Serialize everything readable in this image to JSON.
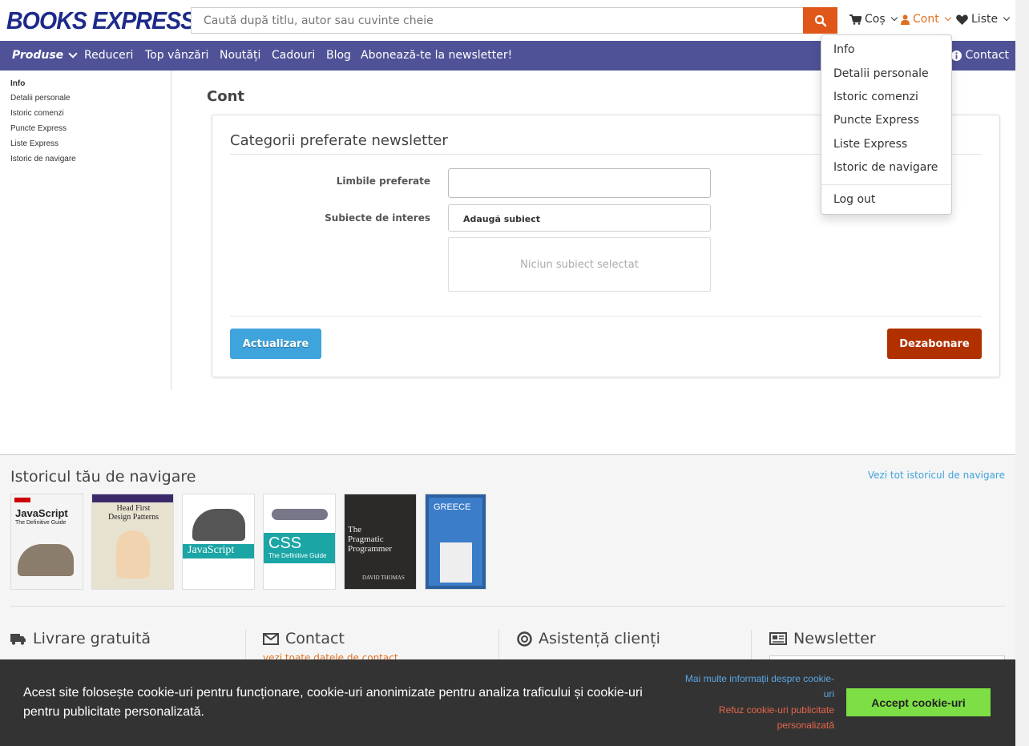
{
  "header": {
    "logo": "BOOKS EXPRESS",
    "search_placeholder": "Caută după titlu, autor sau cuvinte cheie",
    "cart_label": "Coș",
    "account_label": "Cont",
    "lists_label": "Liste"
  },
  "nav": {
    "products": "Produse",
    "items": [
      "Reduceri",
      "Top vânzări",
      "Noutăți",
      "Cadouri",
      "Blog",
      "Abonează-te la newsletter!"
    ],
    "contact": "Contact"
  },
  "sidebar": {
    "items": [
      "Info",
      "Detalii personale",
      "Istoric comenzi",
      "Puncte Express",
      "Liste Express",
      "Istoric de navigare"
    ]
  },
  "main": {
    "page_title": "Cont",
    "panel_title": "Categorii preferate newsletter",
    "languages_label": "Limbile preferate",
    "subjects_label": "Subiecte de interes",
    "add_subject": "Adaugă subiect",
    "no_subject": "Niciun subiect selectat",
    "update_button": "Actualizare",
    "unsubscribe_button": "Dezabonare"
  },
  "account_dropdown": {
    "items": [
      "Info",
      "Detalii personale",
      "Istoric comenzi",
      "Puncte Express",
      "Liste Express",
      "Istoric de navigare"
    ],
    "logout": "Log out"
  },
  "history": {
    "title": "Istoricul tău de navigare",
    "view_all": "Vezi tot istoricul de navigare",
    "books": [
      "JavaScript The Definitive Guide",
      "Head First Design Patterns",
      "JavaScript",
      "CSS The Definitive Guide",
      "The Pragmatic Programmer",
      "Greece & the Greek Islands"
    ]
  },
  "footer": {
    "delivery": "Livrare gratuită",
    "contact": "Contact",
    "contact_sub": "vezi toate datele de contact",
    "support": "Asistență clienți",
    "newsletter": "Newsletter"
  },
  "cookie": {
    "text": "Acest site folosește cookie-uri pentru funcționare, cookie-uri anonimizate pentru analiza traficului și cookie-uri pentru publicitate personalizată.",
    "more_info": "Mai multe informații despre cookie-uri",
    "refuse": "Refuz cookie-uri publicitate personalizată",
    "accept": "Accept cookie-uri"
  },
  "colors": {
    "brand": "#1d2a8a",
    "nav": "#4f5296",
    "accent": "#e0571a",
    "update": "#3fa3dc",
    "unsubscribe": "#b03000",
    "accept": "#7ddf45"
  }
}
